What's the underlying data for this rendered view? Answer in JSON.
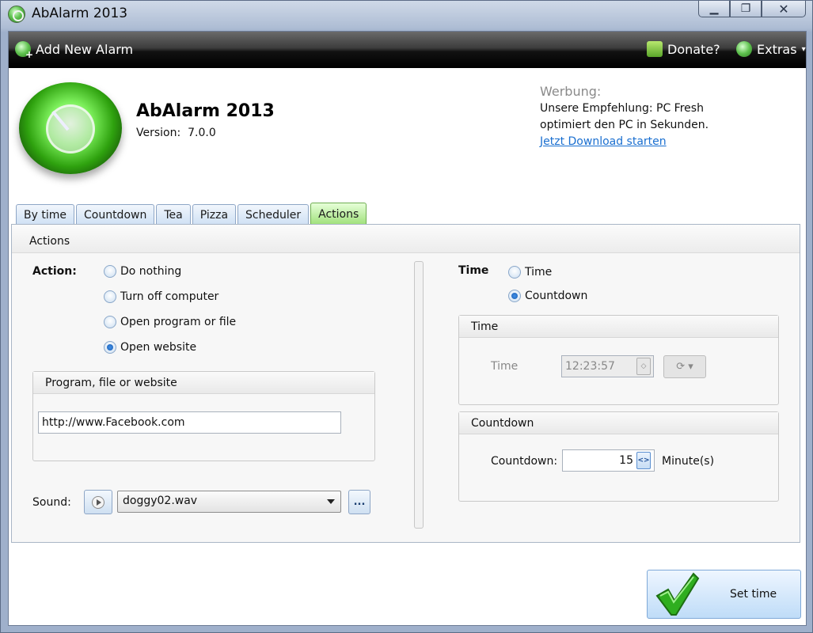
{
  "window": {
    "title": "AbAlarm 2013",
    "controls": {
      "minimize": "▁",
      "maximize": "❐",
      "close": "✕"
    }
  },
  "toolbar": {
    "add_alarm": "Add New Alarm",
    "donate": "Donate?",
    "extras": "Extras",
    "extras_caret": "▾"
  },
  "header": {
    "app_name": "AbAlarm 2013",
    "version_label": "Version:",
    "version_value": "7.0.0"
  },
  "ad": {
    "heading": "Werbung:",
    "line1": "Unsere Empfehlung: PC Fresh",
    "line2": "optimiert den PC in Sekunden.",
    "link": "Jetzt Download starten"
  },
  "tabs": [
    {
      "label": "By time",
      "active": false
    },
    {
      "label": "Countdown",
      "active": false
    },
    {
      "label": "Tea",
      "active": false
    },
    {
      "label": "Pizza",
      "active": false
    },
    {
      "label": "Scheduler",
      "active": false
    },
    {
      "label": "Actions",
      "active": true
    }
  ],
  "panel": {
    "title": "Actions",
    "action_label": "Action:",
    "actions": [
      {
        "label": "Do nothing",
        "selected": false
      },
      {
        "label": "Turn off computer",
        "selected": false
      },
      {
        "label": "Open program or file",
        "selected": false
      },
      {
        "label": "Open website",
        "selected": true
      }
    ],
    "program_group": {
      "title": "Program, file or website",
      "value": "http://www.Facebook.com"
    },
    "sound": {
      "label": "Sound:",
      "selected": "doggy02.wav",
      "browse": "..."
    },
    "time_section": {
      "label": "Time",
      "options": [
        {
          "label": "Time",
          "selected": false
        },
        {
          "label": "Countdown",
          "selected": true
        }
      ],
      "time_group": {
        "title": "Time",
        "field_label": "Time",
        "value": "12:23:57",
        "spin": "◇"
      },
      "countdown_group": {
        "title": "Countdown",
        "field_label": "Countdown:",
        "value": "15",
        "spin": "<>",
        "unit": "Minute(s)"
      }
    }
  },
  "footer": {
    "set_time": "Set time"
  },
  "colors": {
    "accent_green": "#5ec24e",
    "link_blue": "#1a6fd0",
    "toolbar_black": "#000000"
  },
  "icons": {
    "app": "alarm-clock-icon",
    "add": "add-alarm-icon",
    "donate": "gift-icon",
    "extras": "extras-icon",
    "play": "play-icon",
    "refresh": "refresh-icon",
    "check": "checkmark-icon"
  }
}
